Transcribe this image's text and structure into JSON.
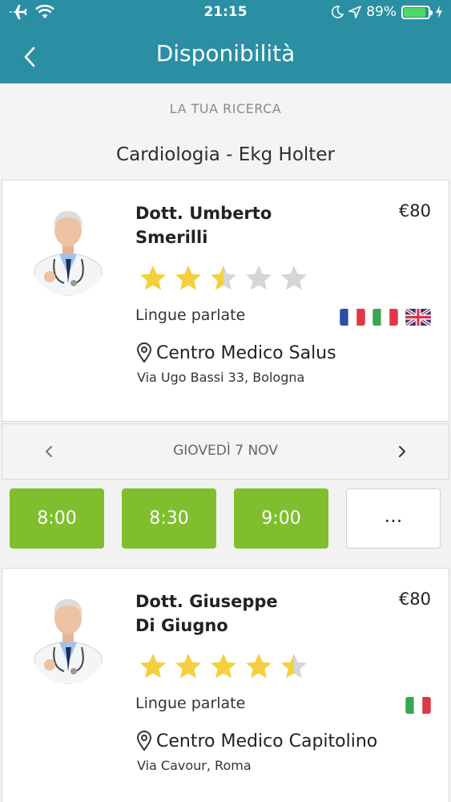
{
  "status_bar": {
    "time": "21:15",
    "battery": "89%",
    "battery_level": 0.89
  },
  "nav": {
    "title": "Disponibilità"
  },
  "search": {
    "label": "LA TUA RICERCA",
    "value": "Cardiologia - Ekg Holter"
  },
  "doctors": [
    {
      "name_line1": "Dott. Umberto",
      "name_line2": "Smerilli",
      "price": "€80",
      "rating": 2.5,
      "languages_label": "Lingue parlate",
      "languages": [
        "fr",
        "it",
        "gb"
      ],
      "center": "Centro Medico Salus",
      "address": "Via Ugo Bassi 33, Bologna"
    },
    {
      "name_line1": "Dott. Giuseppe",
      "name_line2": "Di Giugno",
      "price": "€80",
      "rating": 4.5,
      "languages_label": "Lingue parlate",
      "languages": [
        "it"
      ],
      "center": "Centro Medico Capitolino",
      "address": "Via Cavour, Roma"
    }
  ],
  "date_bar": {
    "date": "GIOVEDÌ 7 NOV"
  },
  "slots": [
    "8:00",
    "8:30",
    "9:00"
  ],
  "more_label": "...",
  "colors": {
    "header": "#2a8fa3",
    "slot_green": "#7fbf2e",
    "star_gold": "#f4d03f",
    "star_grey": "#d6d6d6"
  }
}
